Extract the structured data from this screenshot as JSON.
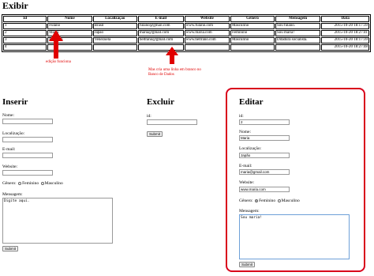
{
  "exibir": {
    "title": "Exibir",
    "columns": [
      "Id",
      "Nome",
      "Localização",
      "E-mail",
      "Website",
      "Gênero",
      "Mensagem",
      "Data"
    ],
    "rows": [
      [
        "1",
        "Fulano",
        "Brasil",
        "fulano@gmail.com",
        "www.fulano.com",
        "Masculino",
        "Sou fulano.",
        "2015-10-20 18:17:39"
      ],
      [
        "2",
        "Maria",
        "Japão",
        "maria@gmail.com",
        "www.maria.com",
        "Feminino",
        "Sou maria!",
        "2015-10-20 18:27:41"
      ],
      [
        "3",
        "Beltrano",
        "Venezuela",
        "beltrano@gmail.com",
        "www.beltrano.com",
        "Masculino",
        "Ditadura socialista.",
        "2015-10-20 18:17:39"
      ],
      [
        "4",
        "",
        "",
        "",
        "",
        "",
        "",
        "2015-10-20 18:27:48"
      ]
    ]
  },
  "annotations": {
    "note_edit": "edição funciona",
    "note_blank": "Mas cria uma linha em branco no Banco de Dados"
  },
  "inserir": {
    "title": "Inserir",
    "nome_label": "Nome:",
    "localizacao_label": "Localização:",
    "email_label": "E-mail:",
    "website_label": "Website:",
    "genero_label": "Gênero:",
    "feminino": "Feminino",
    "masculino": "Masculino",
    "mensagem_label": "Mensagem:",
    "mensagem_value": "Digite aqui.",
    "submit": "Submit"
  },
  "excluir": {
    "title": "Excluir",
    "id_label": "id:",
    "submit": "Submit"
  },
  "editar": {
    "title": "Editar",
    "id_label": "id:",
    "id_value": "2",
    "nome_label": "Nome:",
    "nome_value": "Maria",
    "localizacao_label": "Localização:",
    "localizacao_value": "Japão",
    "email_label": "E-mail:",
    "email_value": "maria@gmail.com",
    "website_label": "Website:",
    "website_value": "www.maria.com",
    "genero_label": "Gênero:",
    "feminino": "Feminino",
    "masculino": "Masculino",
    "genero_selected": "Feminino",
    "mensagem_label": "Mensagem:",
    "mensagem_value": "Sou maria!",
    "submit": "Submit"
  },
  "colors": {
    "highlight": "#d9001b",
    "arrow": "#e00000"
  }
}
